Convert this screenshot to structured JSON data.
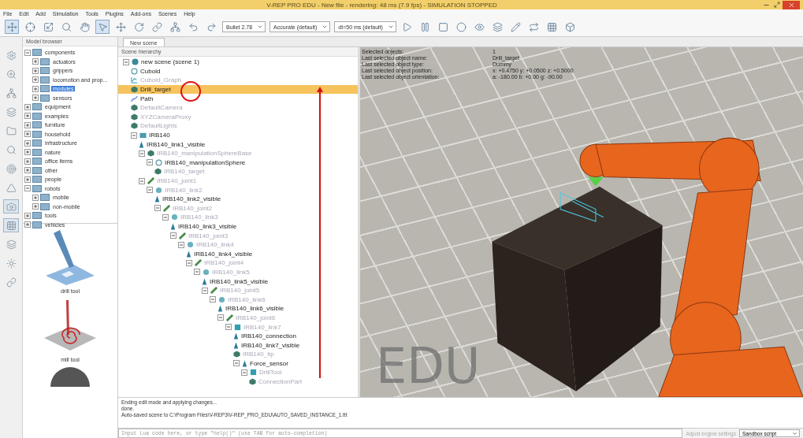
{
  "window": {
    "title": "V-REP PRO EDU - New file - rendering: 48 ms (7.9 fps) - SIMULATION STOPPED"
  },
  "menu": [
    "File",
    "Edit",
    "Add",
    "Simulation",
    "Tools",
    "Plugins",
    "Add-ons",
    "Scenes",
    "Help"
  ],
  "toolbar": {
    "dropdowns": [
      {
        "value": "Bullet 2.78"
      },
      {
        "value": "Accurate (default)"
      },
      {
        "value": "dt=50 ms (default)"
      }
    ]
  },
  "model_browser": {
    "title": "Model browser",
    "items": [
      {
        "label": "components",
        "expanded": true,
        "selected": false,
        "children": [
          {
            "label": "actuators",
            "expanded": false,
            "selected": false
          },
          {
            "label": "grippers",
            "expanded": false,
            "selected": false
          },
          {
            "label": "locomotion and prop...",
            "expanded": false,
            "selected": false
          },
          {
            "label": "modules",
            "expanded": false,
            "selected": true
          },
          {
            "label": "sensors",
            "expanded": false,
            "selected": false
          }
        ]
      },
      {
        "label": "equipment",
        "expanded": false,
        "selected": false
      },
      {
        "label": "examples",
        "expanded": false,
        "selected": false
      },
      {
        "label": "furniture",
        "expanded": false,
        "selected": false
      },
      {
        "label": "household",
        "expanded": false,
        "selected": false
      },
      {
        "label": "infrastructure",
        "expanded": false,
        "selected": false
      },
      {
        "label": "nature",
        "expanded": false,
        "selected": false
      },
      {
        "label": "office items",
        "expanded": false,
        "selected": false
      },
      {
        "label": "other",
        "expanded": false,
        "selected": false
      },
      {
        "label": "people",
        "expanded": false,
        "selected": false
      },
      {
        "label": "robots",
        "expanded": true,
        "selected": false,
        "children": [
          {
            "label": "mobile",
            "expanded": false,
            "selected": false
          },
          {
            "label": "non-mobile",
            "expanded": false,
            "selected": false
          }
        ]
      },
      {
        "label": "tools",
        "expanded": false,
        "selected": false
      },
      {
        "label": "vehicles",
        "expanded": false,
        "selected": false
      }
    ],
    "thumbnails": [
      {
        "label": "drill tool",
        "kind": "drill"
      },
      {
        "label": "mill tool",
        "kind": "mill"
      },
      {
        "kind": "sphere"
      }
    ]
  },
  "scene_tabs": [
    {
      "label": "New scene",
      "selected": true
    }
  ],
  "scene_hierarchy": {
    "title": "Scene hierarchy",
    "items": [
      {
        "label": "new scene (scene 1)",
        "kind": "scene",
        "faded": false,
        "selected": false,
        "children": [
          {
            "label": "Cuboid",
            "kind": "dummy",
            "faded": false,
            "selected": false
          },
          {
            "label": "Cuboid_Graph",
            "kind": "graph",
            "faded": true,
            "selected": false
          },
          {
            "label": "Drill_target",
            "kind": "shape",
            "faded": false,
            "selected": true
          },
          {
            "label": "Path",
            "kind": "path",
            "faded": false,
            "selected": false
          },
          {
            "label": "DefaultCamera",
            "kind": "shape",
            "faded": true,
            "selected": false
          },
          {
            "label": "XYZCameraProxy",
            "kind": "shape",
            "faded": true,
            "selected": false
          },
          {
            "label": "DefaultLights",
            "kind": "shape",
            "faded": true,
            "selected": false
          },
          {
            "label": "IRB140",
            "kind": "model",
            "faded": false,
            "selected": false,
            "children": [
              {
                "label": "IRB140_link1_visible",
                "kind": "visible",
                "faded": false,
                "selected": false
              },
              {
                "label": "IRB140_manipulationSphereBase",
                "kind": "shape",
                "faded": true,
                "selected": false,
                "children": [
                  {
                    "label": "IRB140_manipulationSphere",
                    "kind": "dummy",
                    "faded": false,
                    "selected": false,
                    "children": [
                      {
                        "label": "IRB140_target",
                        "kind": "shape",
                        "faded": true,
                        "selected": false
                      }
                    ]
                  }
                ]
              },
              {
                "label": "IRB140_joint1",
                "kind": "joint",
                "faded": true,
                "selected": false,
                "children": [
                  {
                    "label": "IRB140_link2",
                    "kind": "link",
                    "faded": true,
                    "selected": false,
                    "children": [
                      {
                        "label": "IRB140_link2_visible",
                        "kind": "visible",
                        "faded": false,
                        "selected": false
                      },
                      {
                        "label": "IRB140_joint2",
                        "kind": "joint",
                        "faded": true,
                        "selected": false,
                        "children": [
                          {
                            "label": "IRB140_link3",
                            "kind": "link",
                            "faded": true,
                            "selected": false,
                            "children": [
                              {
                                "label": "IRB140_link3_visible",
                                "kind": "visible",
                                "faded": false,
                                "selected": false
                              },
                              {
                                "label": "IRB140_joint3",
                                "kind": "joint",
                                "faded": true,
                                "selected": false,
                                "children": [
                                  {
                                    "label": "IRB140_link4",
                                    "kind": "link",
                                    "faded": true,
                                    "selected": false,
                                    "children": [
                                      {
                                        "label": "IRB140_link4_visible",
                                        "kind": "visible",
                                        "faded": false,
                                        "selected": false
                                      },
                                      {
                                        "label": "IRB140_joint4",
                                        "kind": "joint",
                                        "faded": true,
                                        "selected": false,
                                        "children": [
                                          {
                                            "label": "IRB140_link5",
                                            "kind": "link",
                                            "faded": true,
                                            "selected": false,
                                            "children": [
                                              {
                                                "label": "IRB140_link5_visible",
                                                "kind": "visible",
                                                "faded": false,
                                                "selected": false
                                              },
                                              {
                                                "label": "IRB140_joint5",
                                                "kind": "joint",
                                                "faded": true,
                                                "selected": false,
                                                "children": [
                                                  {
                                                    "label": "IRB140_link6",
                                                    "kind": "link",
                                                    "faded": true,
                                                    "selected": false,
                                                    "children": [
                                                      {
                                                        "label": "IRB140_link6_visible",
                                                        "kind": "visible",
                                                        "faded": false,
                                                        "selected": false
                                                      },
                                                      {
                                                        "label": "IRB140_joint6",
                                                        "kind": "joint",
                                                        "faded": true,
                                                        "selected": false,
                                                        "children": [
                                                          {
                                                            "label": "IRB140_link7",
                                                            "kind": "box",
                                                            "faded": true,
                                                            "selected": false,
                                                            "children": [
                                                              {
                                                                "label": "IRB140_connection",
                                                                "kind": "visible",
                                                                "faded": false,
                                                                "selected": false
                                                              },
                                                              {
                                                                "label": "IRB140_link7_visible",
                                                                "kind": "visible",
                                                                "faded": false,
                                                                "selected": false
                                                              },
                                                              {
                                                                "label": "IRB140_tip",
                                                                "kind": "shape",
                                                                "faded": true,
                                                                "selected": false
                                                              },
                                                              {
                                                                "label": "Force_sensor",
                                                                "kind": "visible",
                                                                "faded": false,
                                                                "selected": false,
                                                                "children": [
                                                                  {
                                                                    "label": "DrillTool",
                                                                    "kind": "box",
                                                                    "faded": true,
                                                                    "selected": false,
                                                                    "children": [
                                                                      {
                                                                        "label": "ConnectionPart",
                                                                        "kind": "shape",
                                                                        "faded": true,
                                                                        "selected": false
                                                                      }
                                                                    ]
                                                                  }
                                                                ]
                                                              }
                                                            ]
                                                          }
                                                        ]
                                                      }
                                                    ]
                                                  }
                                                ]
                                              }
                                            ]
                                          }
                                        ]
                                      }
                                    ]
                                  }
                                ]
                              }
                            ]
                          }
                        ]
                      }
                    ]
                  }
                ]
              }
            ]
          }
        ]
      }
    ]
  },
  "viewport": {
    "info": [
      {
        "label": "Selected objects:",
        "value": "1"
      },
      {
        "label": "Last selected object name:",
        "value": "Drill_target"
      },
      {
        "label": "Last selected object type:",
        "value": "Dummy"
      },
      {
        "label": "Last selected object position:",
        "value": "x: +0.4750  y: +0.0500  z: +0.5000"
      },
      {
        "label": "Last selected object orientation:",
        "value": "a: -180.00  b: +0.00  g: -90.00"
      }
    ],
    "watermark": "EDU"
  },
  "console": {
    "lines": [
      "Ending edit mode and applying changes...",
      "done.",
      "Auto-saved scene to C:\\Program Files\\V-REP3\\V-REP_PRO_EDU\\AUTO_SAVED_INSTANCE_1.ttt"
    ],
    "placeholder": "Input Lua code here, or type \"help()\" (use TAB for auto-completion)",
    "hint": "Adjust engine settings",
    "script": "Sandbox script"
  }
}
